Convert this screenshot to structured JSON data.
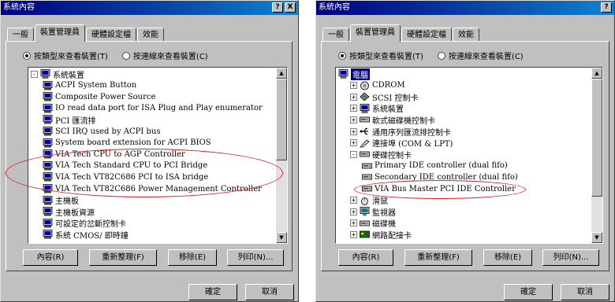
{
  "windows": [
    {
      "title": "系統內容",
      "help_btn": "?",
      "close_btn": "X",
      "tabs": [
        "一般",
        "裝置管理員",
        "硬體設定檔",
        "效能"
      ],
      "radio_by_type": "按類型來查看裝置(T)",
      "radio_by_connection": "按連線來查看裝置(C)",
      "buttons": {
        "properties": "內容(R)",
        "refresh": "重新整理(F)",
        "remove": "移除(E)",
        "print": "列印(N)..."
      },
      "ok": "確定",
      "cancel": "取消",
      "items": [
        {
          "label": "系統裝置",
          "depth": 0,
          "expander": "-",
          "icon": "computer-icon"
        },
        {
          "label": "ACPI System Button",
          "depth": 1,
          "icon": "device-icon"
        },
        {
          "label": "Composite Power Source",
          "depth": 1,
          "icon": "device-icon"
        },
        {
          "label": "IO read data port for ISA Plug and Play enumerator",
          "depth": 1,
          "icon": "device-icon"
        },
        {
          "label": "PCI 匯流排",
          "depth": 1,
          "icon": "device-icon"
        },
        {
          "label": "SCI IRQ used by ACPI bus",
          "depth": 1,
          "icon": "device-icon"
        },
        {
          "label": "System board extension for ACPI BIOS",
          "depth": 1,
          "icon": "device-icon"
        },
        {
          "label": "VIA Tech CPU to AGP Controller",
          "depth": 1,
          "icon": "device-icon"
        },
        {
          "label": "VIA Tech Standard CPU to PCI Bridge",
          "depth": 1,
          "icon": "device-icon"
        },
        {
          "label": "VIA Tech VT82C686 PCI to ISA bridge",
          "depth": 1,
          "icon": "device-icon"
        },
        {
          "label": "VIA Tech VT82C686 Power Management Controller",
          "depth": 1,
          "icon": "device-icon"
        },
        {
          "label": "主機板",
          "depth": 1,
          "icon": "device-icon"
        },
        {
          "label": "主機板資源",
          "depth": 1,
          "icon": "device-icon"
        },
        {
          "label": "可設定的岔斷控制卡",
          "depth": 1,
          "icon": "device-icon"
        },
        {
          "label": "系統 CMOS/ 即時鐘",
          "depth": 1,
          "icon": "device-icon"
        }
      ]
    },
    {
      "title": "系統內容",
      "help_btn": "?",
      "close_btn": "X",
      "tabs": [
        "一般",
        "裝置管理員",
        "硬體設定檔",
        "效能"
      ],
      "radio_by_type": "按類型來查看裝置(T)",
      "radio_by_connection": "按連線來查看裝置(C)",
      "buttons": {
        "properties": "內容(R)",
        "refresh": "重新整理(F)",
        "remove": "移除(E)",
        "print": "列印(N)..."
      },
      "ok": "確定",
      "cancel": "取消",
      "items": [
        {
          "label": "電腦",
          "depth": 0,
          "expander": "",
          "icon": "computer-icon",
          "selected": true
        },
        {
          "label": "CDROM",
          "depth": 1,
          "expander": "+",
          "icon": "cdrom-icon"
        },
        {
          "label": "SCSI 控制卡",
          "depth": 1,
          "expander": "+",
          "icon": "scsi-icon"
        },
        {
          "label": "系統裝置",
          "depth": 1,
          "expander": "+",
          "icon": "computer-icon"
        },
        {
          "label": "軟式磁碟機控制卡",
          "depth": 1,
          "expander": "+",
          "icon": "drive-icon"
        },
        {
          "label": "通用序列匯流排控制卡",
          "depth": 1,
          "expander": "+",
          "icon": "usb-icon"
        },
        {
          "label": "連接埠 (COM & LPT)",
          "depth": 1,
          "expander": "+",
          "icon": "port-icon"
        },
        {
          "label": "硬碟控制卡",
          "depth": 1,
          "expander": "-",
          "icon": "drive-icon"
        },
        {
          "label": "Primary IDE controller (dual fifo)",
          "depth": 2,
          "icon": "drive-icon"
        },
        {
          "label": "Secondary IDE controller (dual fifo)",
          "depth": 2,
          "icon": "drive-icon"
        },
        {
          "label": "VIA Bus Master PCI IDE Controller",
          "depth": 2,
          "icon": "drive-icon"
        },
        {
          "label": "滑鼠",
          "depth": 1,
          "expander": "+",
          "icon": "mouse-icon"
        },
        {
          "label": "監視器",
          "depth": 1,
          "expander": "+",
          "icon": "monitor-icon"
        },
        {
          "label": "磁碟機",
          "depth": 1,
          "expander": "+",
          "icon": "drive-icon"
        },
        {
          "label": "網路配接卡",
          "depth": 1,
          "expander": "+",
          "icon": "network-icon"
        }
      ]
    }
  ],
  "colors": {
    "title_bar": "#000080",
    "highlight": "#e02020",
    "face": "#c0c0c0"
  }
}
